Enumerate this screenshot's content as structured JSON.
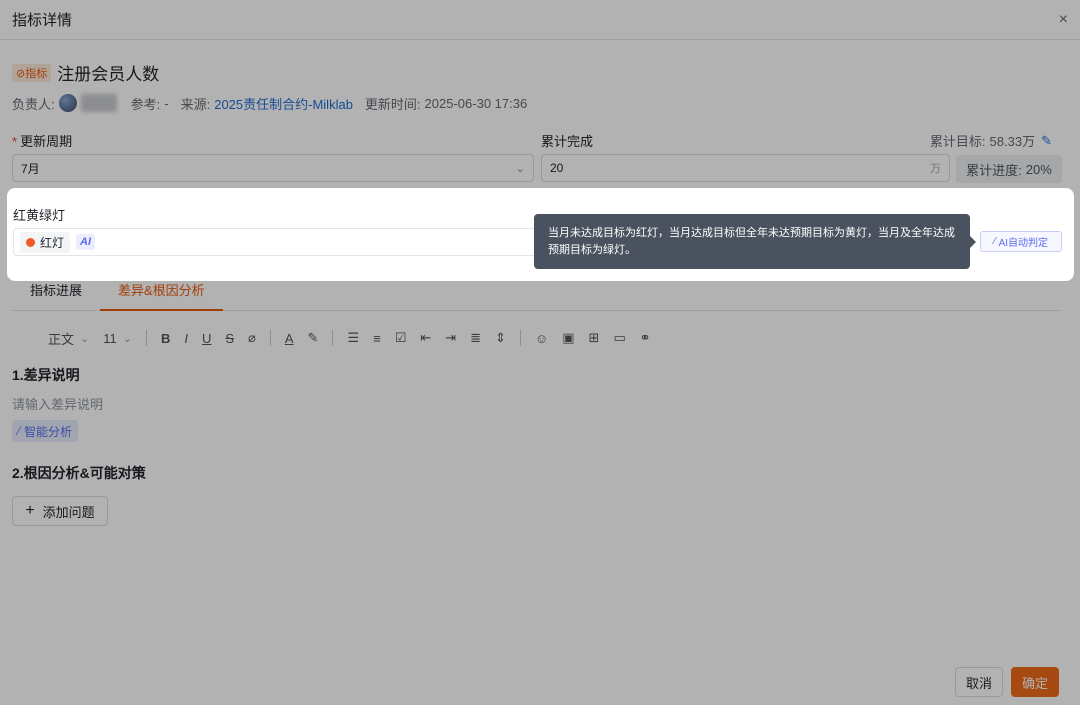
{
  "dialog": {
    "title": "指标详情",
    "close_icon": "×"
  },
  "metric": {
    "tag": "⊘指标",
    "name": "注册会员人数",
    "owner_label": "负责人:",
    "reference_label": "参考:",
    "reference_value": "-",
    "source_label": "来源:",
    "source_link": "2025责任制合约-Milklab",
    "updated_label": "更新时间:",
    "updated_value": "2025-06-30 17:36"
  },
  "form": {
    "period_label": "更新周期",
    "period_value": "7月",
    "cumulative_label": "累计完成",
    "cumulative_value": "20",
    "cumulative_unit": "万",
    "target_label": "累计目标:",
    "target_value": "58.33万",
    "progress_label": "累计进度:",
    "progress_value": "20%"
  },
  "traffic_light": {
    "title": "红黄绿灯",
    "status": "红灯",
    "status_color": "#f05a24",
    "ai_badge": "AI",
    "tooltip": "当月未达成目标为红灯，当月达成目标但全年未达预期目标为黄灯，当月及全年达成预期目标为绿灯。",
    "ai_button": "AI自动判定"
  },
  "tabs": [
    {
      "label": "指标进展"
    },
    {
      "label": "差异&根因分析"
    }
  ],
  "toolbar": {
    "style": "正文",
    "size": "11"
  },
  "sections": {
    "diff_title": "1.差异说明",
    "diff_placeholder": "请输入差异说明",
    "smart_button": "智能分析",
    "root_title": "2.根因分析&可能对策",
    "add_button": "添加问题"
  },
  "footer": {
    "cancel": "取消",
    "confirm": "确定"
  },
  "colors": {
    "accent": "#f06a1a",
    "link": "#1f6fd6",
    "ai": "#5b6cf0"
  }
}
